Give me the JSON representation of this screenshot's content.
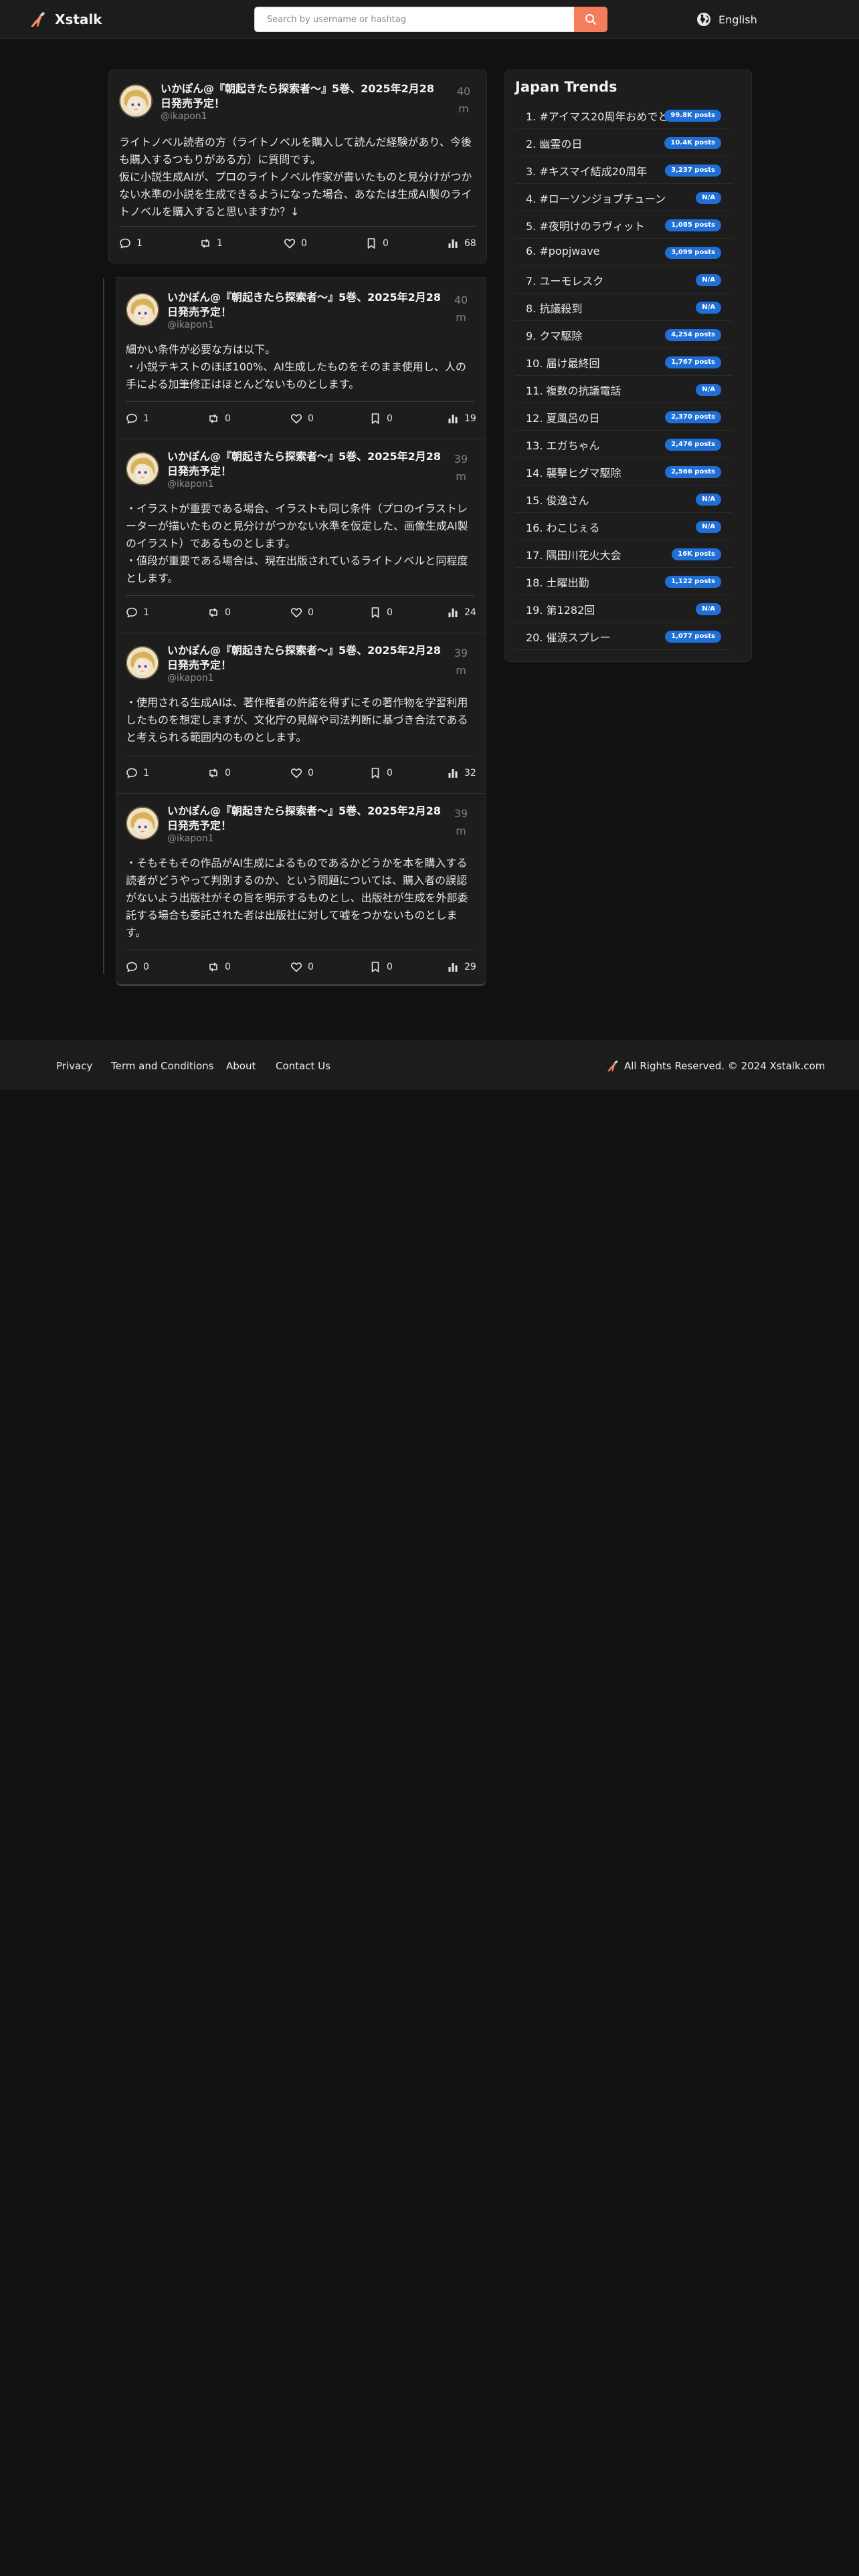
{
  "header": {
    "brand": "Xstalk",
    "search_placeholder": "Search by username or hashtag",
    "language": "English"
  },
  "posts": [
    {
      "author": "いかぽん@『朝起きたら探索者〜』5巻、2025年2月28日発売予定！",
      "handle": "@ikapon1",
      "time": "40 m",
      "text": "ライトノベル読者の方（ライトノベルを購入して読んだ経験があり、今後も購入するつもりがある方）に質問です。\n仮に小説生成AIが、プロのライトノベル作家が書いたものと見分けがつかない水準の小説を生成できるようになった場合、あなたは生成AI製のライトノベルを購入すると思いますか？↓",
      "replies": "1",
      "reposts": "1",
      "likes": "0",
      "bookmarks": "0",
      "views": "68"
    },
    {
      "author": "いかぽん@『朝起きたら探索者〜』5巻、2025年2月28日発売予定！",
      "handle": "@ikapon1",
      "time": "40 m",
      "text": "細かい条件が必要な方は以下。\n・小説テキストのほぼ100%、AI生成したものをそのまま使用し、人の手による加筆修正はほとんどないものとします。",
      "replies": "1",
      "reposts": "0",
      "likes": "0",
      "bookmarks": "0",
      "views": "19"
    },
    {
      "author": "いかぽん@『朝起きたら探索者〜』5巻、2025年2月28日発売予定！",
      "handle": "@ikapon1",
      "time": "39 m",
      "text": "・イラストが重要である場合、イラストも同じ条件（プロのイラストレーターが描いたものと見分けがつかない水準を仮定した、画像生成AI製のイラスト）であるものとします。\n・値段が重要である場合は、現在出版されているライトノベルと同程度とします。",
      "replies": "1",
      "reposts": "0",
      "likes": "0",
      "bookmarks": "0",
      "views": "24"
    },
    {
      "author": "いかぽん@『朝起きたら探索者〜』5巻、2025年2月28日発売予定！",
      "handle": "@ikapon1",
      "time": "39 m",
      "text": "・使用される生成AIは、著作権者の許諾を得ずにその著作物を学習利用したものを想定しますが、文化庁の見解や司法判断に基づき合法であると考えられる範囲内のものとします。",
      "replies": "1",
      "reposts": "0",
      "likes": "0",
      "bookmarks": "0",
      "views": "32"
    },
    {
      "author": "いかぽん@『朝起きたら探索者〜』5巻、2025年2月28日発売予定！",
      "handle": "@ikapon1",
      "time": "39 m",
      "text": "・そもそもその作品がAI生成によるものであるかどうかを本を購入する読者がどうやって判別するのか、という問題については、購入者の誤認がないよう出版社がその旨を明示するものとし、出版社が生成を外部委託する場合も委託された者は出版社に対して嘘をつかないものとします。",
      "replies": "0",
      "reposts": "0",
      "likes": "0",
      "bookmarks": "0",
      "views": "29"
    }
  ],
  "trends": {
    "title": "Japan Trends",
    "items": [
      {
        "label": "1. #アイマス20周年おめでとう",
        "count": "99.8K posts"
      },
      {
        "label": "2. 幽霊の日",
        "count": "10.4K posts"
      },
      {
        "label": "3. #キスマイ結成20周年",
        "count": "3,237 posts"
      },
      {
        "label": "4. #ローソンジョブチューン",
        "count": "N/A"
      },
      {
        "label": "5. #夜明けのラヴィット",
        "count": "1,085 posts"
      },
      {
        "label": "6. #popjwave",
        "count": "3,099 posts"
      },
      {
        "label": "7. ユーモレスク",
        "count": "N/A"
      },
      {
        "label": "8. 抗議殺到",
        "count": "N/A"
      },
      {
        "label": "9. クマ駆除",
        "count": "4,254 posts"
      },
      {
        "label": "10. 届け最終回",
        "count": "1,767 posts"
      },
      {
        "label": "11. 複数の抗議電話",
        "count": "N/A"
      },
      {
        "label": "12. 夏風呂の日",
        "count": "2,370 posts"
      },
      {
        "label": "13. エガちゃん",
        "count": "2,476 posts"
      },
      {
        "label": "14. 襲撃ヒグマ駆除",
        "count": "2,566 posts"
      },
      {
        "label": "15. 俊逸さん",
        "count": "N/A"
      },
      {
        "label": "16. わこじぇる",
        "count": "N/A"
      },
      {
        "label": "17. 隅田川花火大会",
        "count": "16K posts"
      },
      {
        "label": "18. 土曜出勤",
        "count": "1,122 posts"
      },
      {
        "label": "19. 第1282回",
        "count": "N/A"
      },
      {
        "label": "20. 催涙スプレー",
        "count": "1,077 posts"
      }
    ]
  },
  "footer": {
    "links": [
      "Privacy",
      "Term and Conditions",
      "About",
      "Contact Us"
    ],
    "copyright": "All Rights Reserved. © 2024 Xstalk.com"
  },
  "colors": {
    "accent": "#f57c5c",
    "badge": "#1f6fd6",
    "background": "#111111",
    "card": "#1d1d1d"
  }
}
